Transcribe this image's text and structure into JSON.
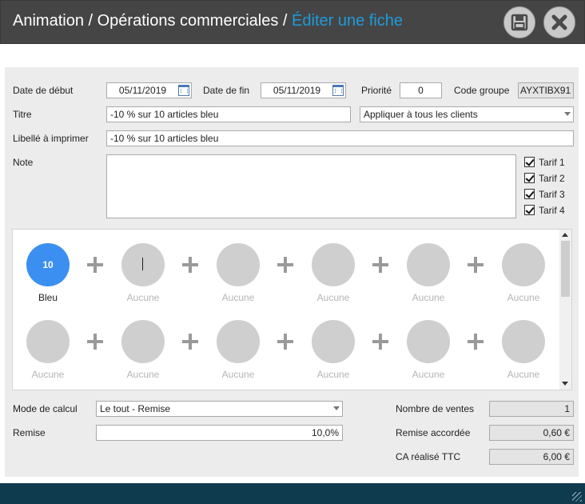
{
  "header": {
    "crumb_1": "Animation",
    "sep_1": " / ",
    "crumb_2": "Opérations commerciales",
    "sep_2": " / ",
    "crumb_3": "Éditer une fiche",
    "accent_color": "#1e9bdc",
    "save_icon": "floppy-disk-icon",
    "close_icon": "close-x-icon"
  },
  "form": {
    "start_date_label": "Date de début",
    "start_date_value": "05/11/2019",
    "end_date_label": "Date de fin",
    "end_date_value": "05/11/2019",
    "priority_label": "Priorité",
    "priority_value": "0",
    "group_code_label": "Code groupe",
    "group_code_value": "AYXTIBX91",
    "title_label": "Titre",
    "title_value": "-10 % sur 10 articles bleu",
    "apply_to_value": "Appliquer à tous les clients",
    "print_label_label": "Libellé à imprimer",
    "print_label_value": "-10 % sur 10 articles bleu",
    "note_label": "Note",
    "note_value": "",
    "tarifs": [
      {
        "label": "Tarif 1",
        "checked": true
      },
      {
        "label": "Tarif 2",
        "checked": true
      },
      {
        "label": "Tarif 3",
        "checked": true
      },
      {
        "label": "Tarif 4",
        "checked": true
      }
    ]
  },
  "combo": {
    "row1": [
      {
        "label": "Bleu",
        "badge": "10",
        "active": true
      },
      {
        "label": "Aucune"
      },
      {
        "label": "Aucune"
      },
      {
        "label": "Aucune"
      },
      {
        "label": "Aucune"
      },
      {
        "label": "Aucune"
      }
    ],
    "row2": [
      {
        "label": "Aucune"
      },
      {
        "label": "Aucune"
      },
      {
        "label": "Aucune"
      },
      {
        "label": "Aucune"
      },
      {
        "label": "Aucune"
      },
      {
        "label": "Aucune"
      }
    ],
    "active_color": "#3b8ff0"
  },
  "calc": {
    "mode_label": "Mode de calcul",
    "mode_value": "Le tout - Remise",
    "discount_label": "Remise",
    "discount_value": "10,0%",
    "sales_count_label": "Nombre de ventes",
    "sales_count_value": "1",
    "granted_label": "Remise accordée",
    "granted_value": "0,60 €",
    "revenue_label": "CA réalisé TTC",
    "revenue_value": "6,00 €"
  },
  "footer": {
    "bar_color": "#0f3b4f"
  }
}
